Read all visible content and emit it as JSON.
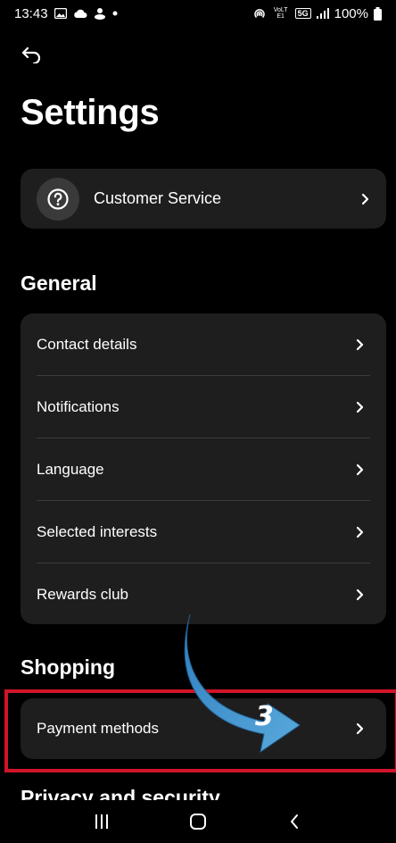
{
  "status_bar": {
    "time": "13:43",
    "battery": "100%",
    "network_label": "5G",
    "volte_label": "VoLTE1"
  },
  "header": {
    "title": "Settings",
    "back_icon": "back-arrow-icon"
  },
  "customer_service": {
    "label": "Customer Service",
    "icon": "help-circle-icon"
  },
  "general": {
    "title": "General",
    "items": [
      {
        "label": "Contact details"
      },
      {
        "label": "Notifications"
      },
      {
        "label": "Language"
      },
      {
        "label": "Selected interests"
      },
      {
        "label": "Rewards club"
      }
    ]
  },
  "shopping": {
    "title": "Shopping",
    "items": [
      {
        "label": "Payment methods"
      }
    ]
  },
  "partial_section": {
    "title": "Privacy and security"
  },
  "annotation": {
    "step_number": "3",
    "highlight_color": "#d0142a",
    "arrow_color": "#3b8fc9"
  },
  "colors": {
    "background": "#000000",
    "card": "#1e1e1e",
    "divider": "#3c3c3c",
    "text": "#ffffff"
  }
}
